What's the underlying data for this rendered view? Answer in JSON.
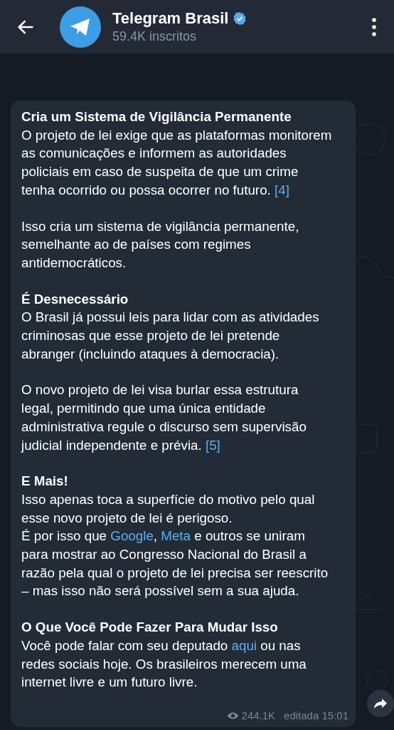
{
  "header": {
    "title": "Telegram Brasil",
    "verified": true,
    "subtitle": "59.4K inscritos"
  },
  "message": {
    "blocks": [
      {
        "heading": "Cria um Sistema de Vigilância Permanente",
        "lines": [
          [
            {
              "text": "O projeto de lei exige que as plataformas monitorem as comunicações e informem as autoridades policiais em caso de suspeita de que um crime tenha ocorrido ou possa ocorrer no futuro. ",
              "kind": "text"
            },
            {
              "text": "[4]",
              "kind": "link"
            }
          ]
        ]
      },
      {
        "lines": [
          [
            {
              "text": "Isso cria um sistema de vigilância permanente, semelhante ao de países com regimes antidemocráticos.",
              "kind": "text"
            }
          ]
        ]
      },
      {
        "heading": "É Desnecessário",
        "lines": [
          [
            {
              "text": "O Brasil já possui leis para lidar com as atividades criminosas que esse projeto de lei pretende abranger (incluindo ataques à democracia).",
              "kind": "text"
            }
          ]
        ]
      },
      {
        "lines": [
          [
            {
              "text": "O novo projeto de lei visa burlar essa estrutura legal, permitindo que uma única entidade administrativa regule o discurso sem supervisão judicial independente e prévia. ",
              "kind": "text"
            },
            {
              "text": "[5]",
              "kind": "link"
            }
          ]
        ]
      },
      {
        "heading": "E Mais!",
        "lines": [
          [
            {
              "text": "Isso apenas toca a superfície do motivo pelo qual esse novo projeto de lei é perigoso.",
              "kind": "text"
            }
          ],
          [
            {
              "text": "É por isso que ",
              "kind": "text"
            },
            {
              "text": "Google",
              "kind": "link"
            },
            {
              "text": ", ",
              "kind": "text"
            },
            {
              "text": "Meta",
              "kind": "link"
            },
            {
              "text": " e outros se uniram para mostrar ao Congresso Nacional do Brasil a razão pela qual o projeto de lei precisa ser reescrito – mas isso não será possível sem a sua ajuda.",
              "kind": "text"
            }
          ]
        ]
      },
      {
        "heading": "O Que Você Pode Fazer Para Mudar Isso",
        "lines": [
          [
            {
              "text": "Você pode falar com seu deputado ",
              "kind": "text"
            },
            {
              "text": "aqui",
              "kind": "link"
            },
            {
              "text": " ou nas redes sociais hoje. Os brasileiros merecem uma internet livre e um futuro livre.",
              "kind": "text"
            }
          ]
        ]
      }
    ],
    "views": "244.1K",
    "time": "editada 15:01"
  }
}
